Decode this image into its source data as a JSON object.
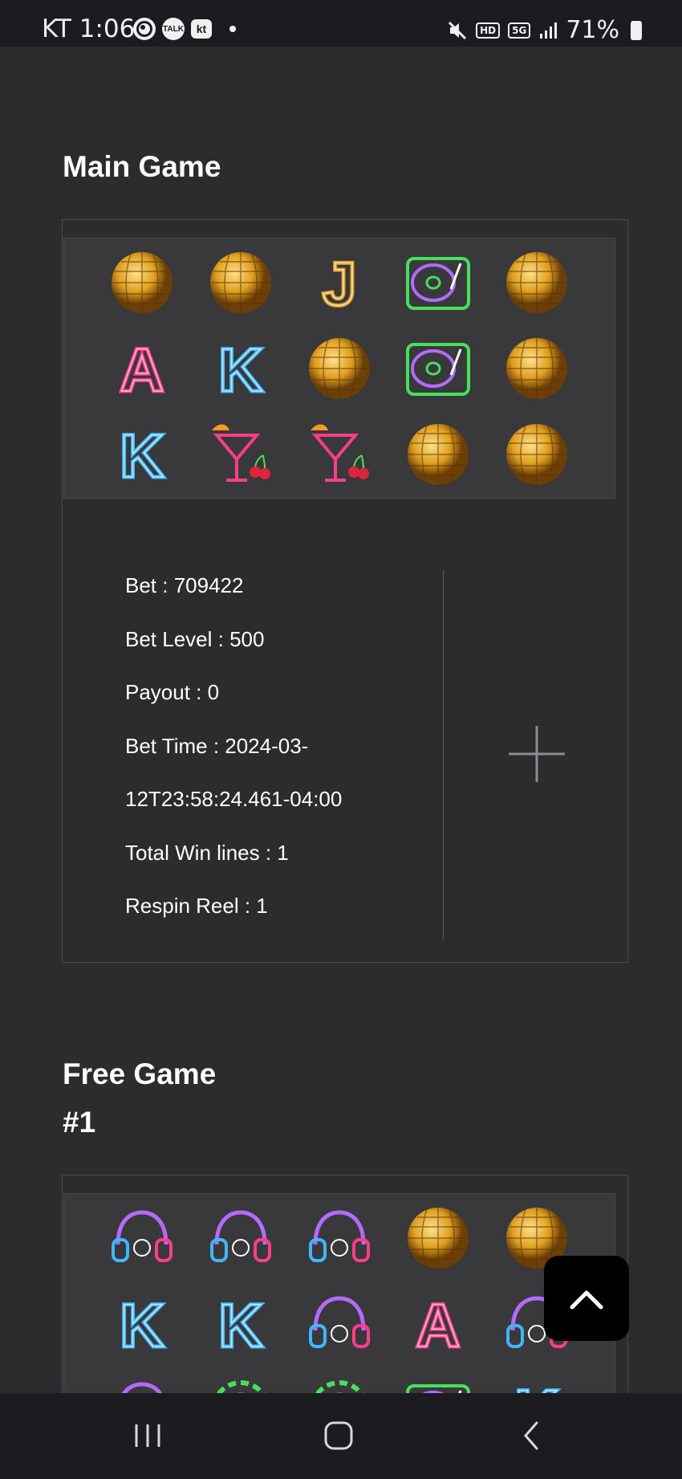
{
  "status_bar": {
    "time": "KT 1:06",
    "notification_icons": [
      "world-icon",
      "talk-icon",
      "kt-icon"
    ],
    "talk_label": "TALK",
    "kt_label": "kt",
    "hd_label": "HD",
    "network_label": "5G",
    "battery": "71%"
  },
  "main_game": {
    "title": "Main Game",
    "reels": [
      [
        "disco-ball",
        "disco-ball",
        "letter-J",
        "turntable",
        "disco-ball"
      ],
      [
        "letter-A",
        "letter-K",
        "disco-ball",
        "turntable",
        "disco-ball"
      ],
      [
        "letter-K",
        "cocktail",
        "cocktail",
        "disco-ball",
        "disco-ball"
      ]
    ],
    "info": {
      "bet": "Bet : 709422",
      "bet_level": "Bet Level : 500",
      "payout": "Payout : 0",
      "bet_time_1": "Bet Time : 2024-03-",
      "bet_time_2": "12T23:58:24.461-04:00",
      "total_win_lines": "Total Win lines : 1",
      "respin_reel": "Respin Reel : 1"
    }
  },
  "free_game": {
    "title_line1": "Free Game",
    "title_line2": "#1",
    "reels": [
      [
        "headphones",
        "headphones",
        "headphones",
        "disco-ball",
        "disco-ball"
      ],
      [
        "letter-K",
        "letter-K",
        "headphones",
        "letter-A",
        "headphones"
      ],
      [
        "headphones",
        "green-chip",
        "green-chip",
        "turntable",
        "letter-K"
      ]
    ]
  },
  "colors": {
    "background": "#2c2b2e",
    "bar": "#1c1b1f",
    "gold": "#e0a020",
    "neon_pink": "#ff3d8b",
    "neon_blue": "#3fb6ff",
    "neon_green": "#46e05a",
    "neon_purple": "#b36bff"
  },
  "scroll_top_icon": "chevron-up-icon",
  "nav": {
    "recent_icon": "recent-apps-icon",
    "home_icon": "home-icon",
    "back_icon": "back-icon"
  }
}
